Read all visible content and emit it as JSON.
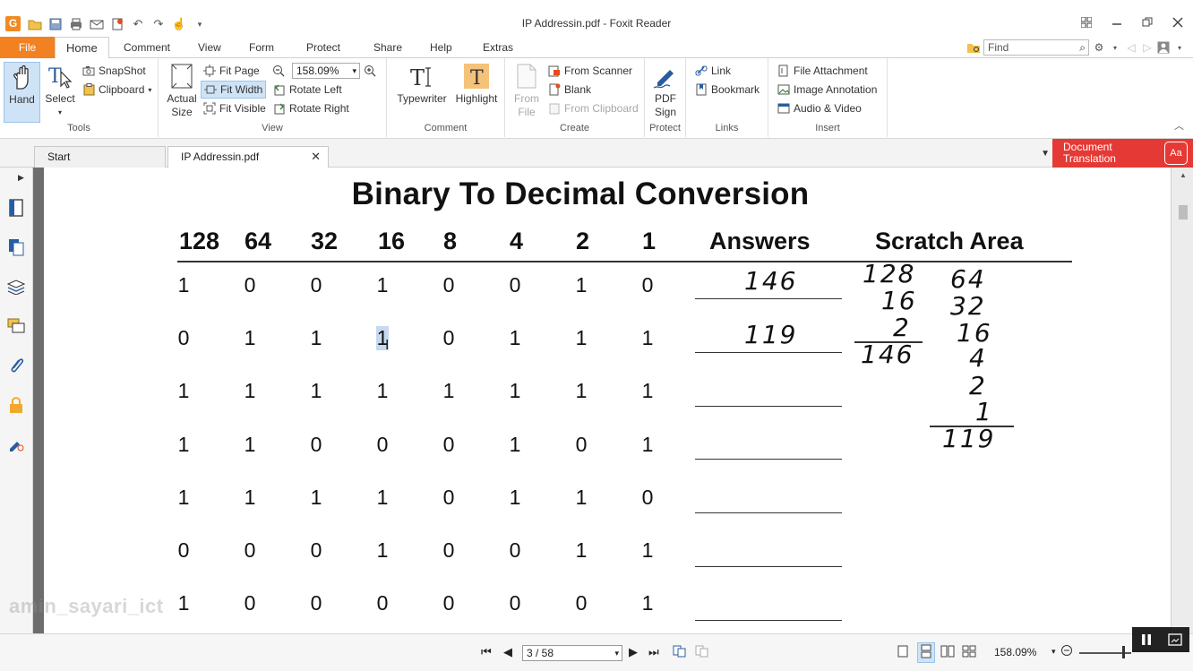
{
  "window": {
    "title": "IP Addressin.pdf - Foxit Reader"
  },
  "menu": {
    "file": "File",
    "tabs": [
      "Home",
      "Comment",
      "View",
      "Form",
      "Protect",
      "Share",
      "Help",
      "Extras"
    ],
    "find_placeholder": "Find"
  },
  "ribbon": {
    "tools": {
      "label": "Tools",
      "hand": "Hand",
      "select": "Select",
      "snapshot": "SnapShot",
      "clipboard": "Clipboard"
    },
    "view": {
      "label": "View",
      "actual_size_1": "Actual",
      "actual_size_2": "Size",
      "fit_page": "Fit Page",
      "fit_width": "Fit Width",
      "fit_visible": "Fit Visible",
      "zoom_value": "158.09%",
      "rotate_left": "Rotate Left",
      "rotate_right": "Rotate Right"
    },
    "comment": {
      "label": "Comment",
      "typewriter": "Typewriter",
      "highlight": "Highlight"
    },
    "create": {
      "label": "Create",
      "from_file_1": "From",
      "from_file_2": "File",
      "from_scanner": "From Scanner",
      "blank": "Blank",
      "from_clipboard": "From Clipboard"
    },
    "protect": {
      "label": "Protect",
      "pdf_sign_1": "PDF",
      "pdf_sign_2": "Sign"
    },
    "links": {
      "label": "Links",
      "link": "Link",
      "bookmark": "Bookmark"
    },
    "insert": {
      "label": "Insert",
      "file_attachment": "File Attachment",
      "image_annotation": "Image Annotation",
      "audio_video": "Audio & Video"
    }
  },
  "doc_tabs": {
    "start": "Start",
    "active": "IP Addressin.pdf",
    "translation_1": "Document",
    "translation_2": "Translation",
    "translation_icon": "Aa"
  },
  "document": {
    "title": "Binary To Decimal Conversion",
    "headers": [
      "128",
      "64",
      "32",
      "16",
      "8",
      "4",
      "2",
      "1"
    ],
    "answers_header": "Answers",
    "scratch_header": "Scratch Area",
    "rows": [
      [
        "1",
        "0",
        "0",
        "1",
        "0",
        "0",
        "1",
        "0"
      ],
      [
        "0",
        "1",
        "1",
        "1",
        "0",
        "1",
        "1",
        "1"
      ],
      [
        "1",
        "1",
        "1",
        "1",
        "1",
        "1",
        "1",
        "1"
      ],
      [
        "1",
        "1",
        "0",
        "0",
        "0",
        "1",
        "0",
        "1"
      ],
      [
        "1",
        "1",
        "1",
        "1",
        "0",
        "1",
        "1",
        "0"
      ],
      [
        "0",
        "0",
        "0",
        "1",
        "0",
        "0",
        "1",
        "1"
      ],
      [
        "1",
        "0",
        "0",
        "0",
        "0",
        "0",
        "0",
        "1"
      ]
    ],
    "answers": [
      "146",
      "119"
    ],
    "scratch_col1": [
      "128",
      "16",
      "2",
      "146"
    ],
    "scratch_col2": [
      "64",
      "32",
      "16",
      "4",
      "2",
      "1",
      "119"
    ]
  },
  "watermark": "amin_sayari_ict",
  "status": {
    "page": "3 / 58",
    "zoom": "158.09%"
  }
}
